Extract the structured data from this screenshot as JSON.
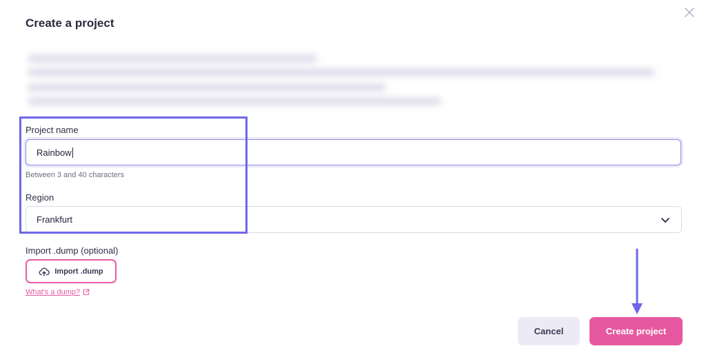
{
  "dialog": {
    "title": "Create a project"
  },
  "form": {
    "project_name": {
      "label": "Project name",
      "value": "Rainbow",
      "hint": "Between 3 and 40 characters"
    },
    "region": {
      "label": "Region",
      "selected": "Frankfurt"
    },
    "import": {
      "label": "Import .dump (optional)",
      "button_label": "Import .dump",
      "help_link": "What's a dump?"
    }
  },
  "actions": {
    "cancel_label": "Cancel",
    "create_label": "Create project"
  },
  "colors": {
    "accent_pink": "#e6589f",
    "annotation_purple": "#6e66e6",
    "focus_border": "#8e8ae6"
  },
  "icons": {
    "close": "close-icon",
    "chevron": "chevron-down-icon",
    "upload": "cloud-upload-icon",
    "external": "external-link-icon"
  }
}
